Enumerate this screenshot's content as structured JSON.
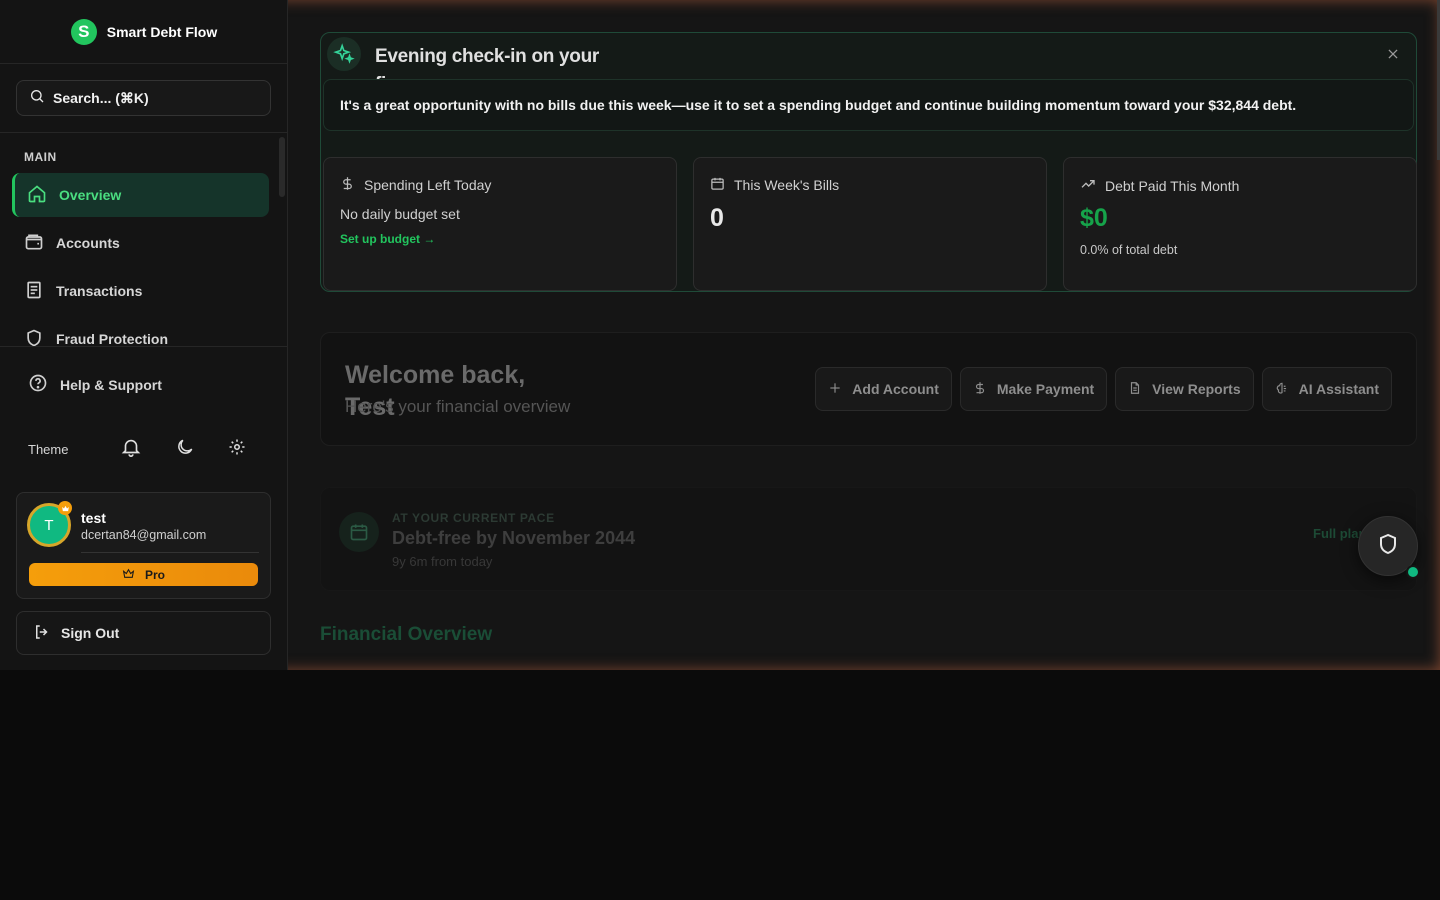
{
  "brand": {
    "logo_letter": "S",
    "name": "Smart Debt Flow"
  },
  "search": {
    "placeholder": "Search... (⌘K)"
  },
  "nav": {
    "section": "MAIN",
    "items": [
      {
        "label": "Overview",
        "icon": "home-icon",
        "active": true
      },
      {
        "label": "Accounts",
        "icon": "wallet-icon"
      },
      {
        "label": "Transactions",
        "icon": "receipt-icon"
      },
      {
        "label": "Fraud Protection",
        "icon": "shield-icon"
      }
    ]
  },
  "help": {
    "label": "Help & Support"
  },
  "theme": {
    "label": "Theme"
  },
  "user": {
    "initial": "T",
    "name": "test",
    "email": "dcertan84@gmail.com",
    "plan": "Pro"
  },
  "signout": {
    "label": "Sign Out"
  },
  "checkin": {
    "title": "Evening check-in on your finances",
    "message": "It's a great opportunity with no bills due this week—use it to set a spending budget and continue building momentum toward your $32,844 debt."
  },
  "stats": {
    "spending": {
      "title": "Spending Left Today",
      "sub": "No daily budget set",
      "link": "Set up budget →"
    },
    "bills": {
      "title": "This Week's Bills",
      "value": "0"
    },
    "debt": {
      "title": "Debt Paid This Month",
      "value": "$0",
      "note": "0.0% of total debt"
    }
  },
  "welcome": {
    "title_line1": "Welcome back,",
    "title_line2": "Test",
    "subtitle": "Here's your financial overview",
    "actions": [
      {
        "label": "Add Account",
        "icon": "plus-icon"
      },
      {
        "label": "Make Payment",
        "icon": "dollar-icon"
      },
      {
        "label": "View Reports",
        "icon": "document-icon"
      },
      {
        "label": "AI Assistant",
        "icon": "brain-icon"
      }
    ]
  },
  "pace": {
    "overline": "AT YOUR CURRENT PACE",
    "title": "Debt-free by November 2044",
    "sub": "9y 6m from today",
    "link": "Full plan"
  },
  "financial_overview": {
    "title": "Financial Overview"
  },
  "colors": {
    "accent": "#22c55e",
    "pro": "#f59e0b",
    "background": "#151515"
  }
}
